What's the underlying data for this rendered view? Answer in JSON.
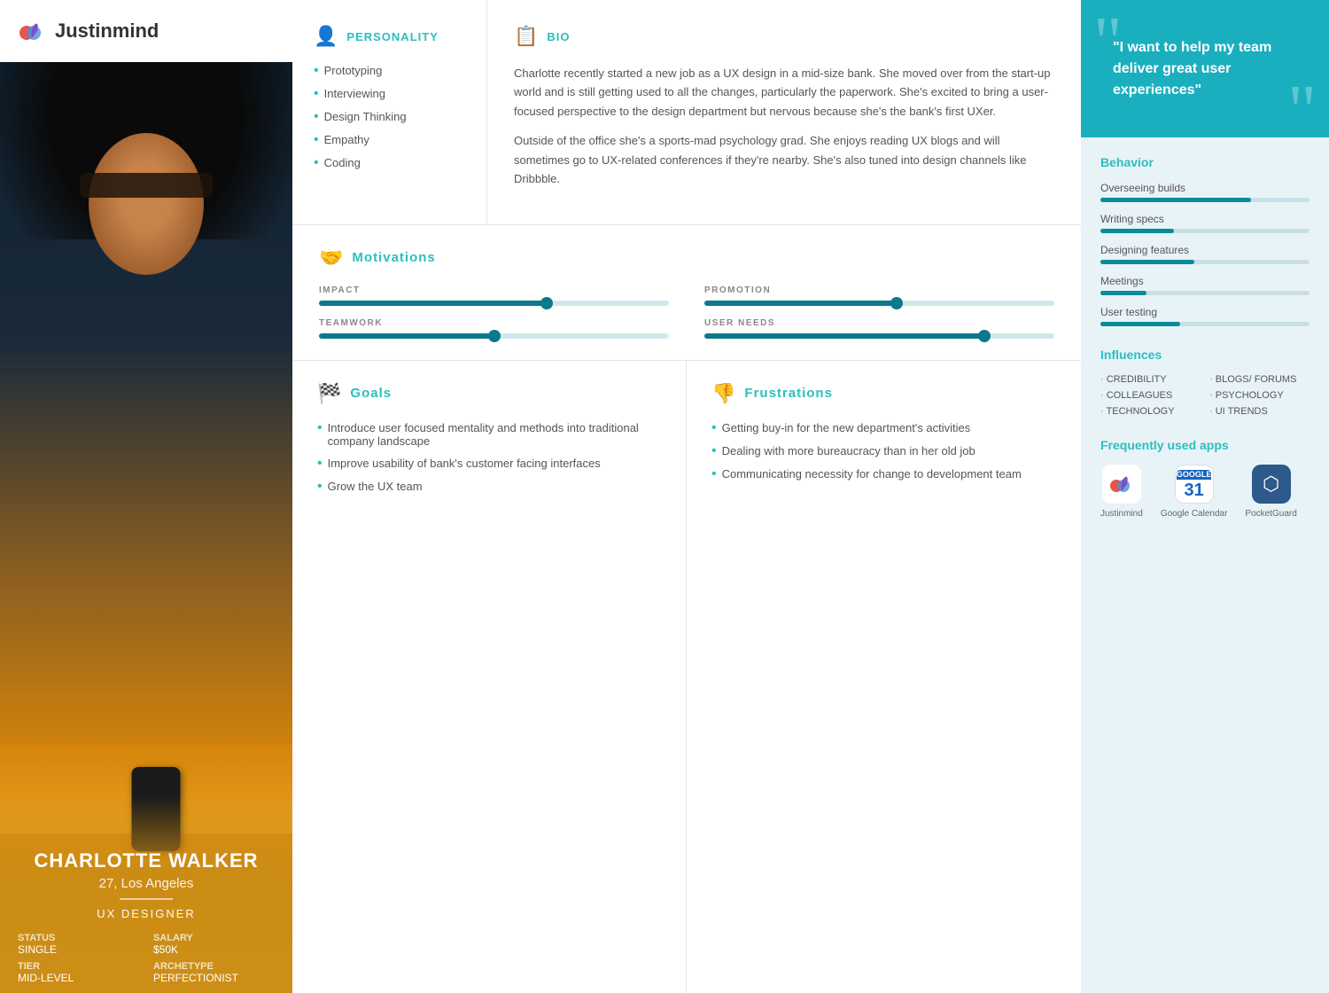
{
  "logo": {
    "text": "Justinmind"
  },
  "person": {
    "name": "CHARLOTTE WALKER",
    "age": "27, Los Angeles",
    "role": "UX DESIGNER",
    "status_label": "STATUS",
    "status_value": "SINGLE",
    "salary_label": "SALARY",
    "salary_value": "$50K",
    "tier_label": "TIER",
    "tier_value": "MID-LEVEL",
    "archetype_label": "ARCHETYPE",
    "archetype_value": "PERFECTIONIST"
  },
  "personality": {
    "title": "PERSONALITY",
    "items": [
      "Prototyping",
      "Interviewing",
      "Design Thinking",
      "Empathy",
      "Coding"
    ]
  },
  "bio": {
    "title": "BIO",
    "para1": "Charlotte recently started a new job as a UX design in a mid-size bank. She moved over from the start-up world and is still getting used to all the changes, particularly the paperwork. She's excited to bring a user-focused perspective to the design department but nervous because she's the bank's first UXer.",
    "para2": "Outside of the office she's a sports-mad psychology grad. She enjoys reading UX blogs and will sometimes go to UX-related conferences if they're nearby. She's also tuned into design channels like Dribbble."
  },
  "motivations": {
    "title": "Motivations",
    "items": [
      {
        "label": "IMPACT",
        "value": 65
      },
      {
        "label": "PROMOTION",
        "value": 55
      },
      {
        "label": "TEAMWORK",
        "value": 50
      },
      {
        "label": "USER NEEDS",
        "value": 80
      }
    ]
  },
  "goals": {
    "title": "Goals",
    "items": [
      "Introduce user focused mentality and methods into traditional company landscape",
      "Improve usability of bank's customer facing interfaces",
      "Grow the UX team"
    ]
  },
  "frustrations": {
    "title": "Frustrations",
    "items": [
      "Getting buy-in for the new department's activities",
      "Dealing with more bureaucracy than in her old job",
      "Communicating necessity for change to development team"
    ]
  },
  "quote": {
    "text": "\"I want to help my team deliver great user experiences\""
  },
  "behavior": {
    "title": "Behavior",
    "items": [
      {
        "label": "Overseeing builds",
        "value": 72
      },
      {
        "label": "Writing specs",
        "value": 35
      },
      {
        "label": "Designing features",
        "value": 45
      },
      {
        "label": "Meetings",
        "value": 22
      },
      {
        "label": "User testing",
        "value": 38
      }
    ]
  },
  "influences": {
    "title": "Influences",
    "items": [
      "CREDIBILITY",
      "BLOGS/ FORUMS",
      "COLLEAGUES",
      "PSYCHOLOGY",
      "TECHNOLOGY",
      "UI TRENDS"
    ]
  },
  "apps": {
    "title": "Frequently used apps",
    "items": [
      {
        "name": "Justinmind",
        "icon_type": "justinmind"
      },
      {
        "name": "Google Calendar",
        "icon_type": "gcal",
        "icon_text": "31"
      },
      {
        "name": "PocketGuard",
        "icon_type": "pocketguard",
        "icon_text": "⬡"
      }
    ]
  }
}
